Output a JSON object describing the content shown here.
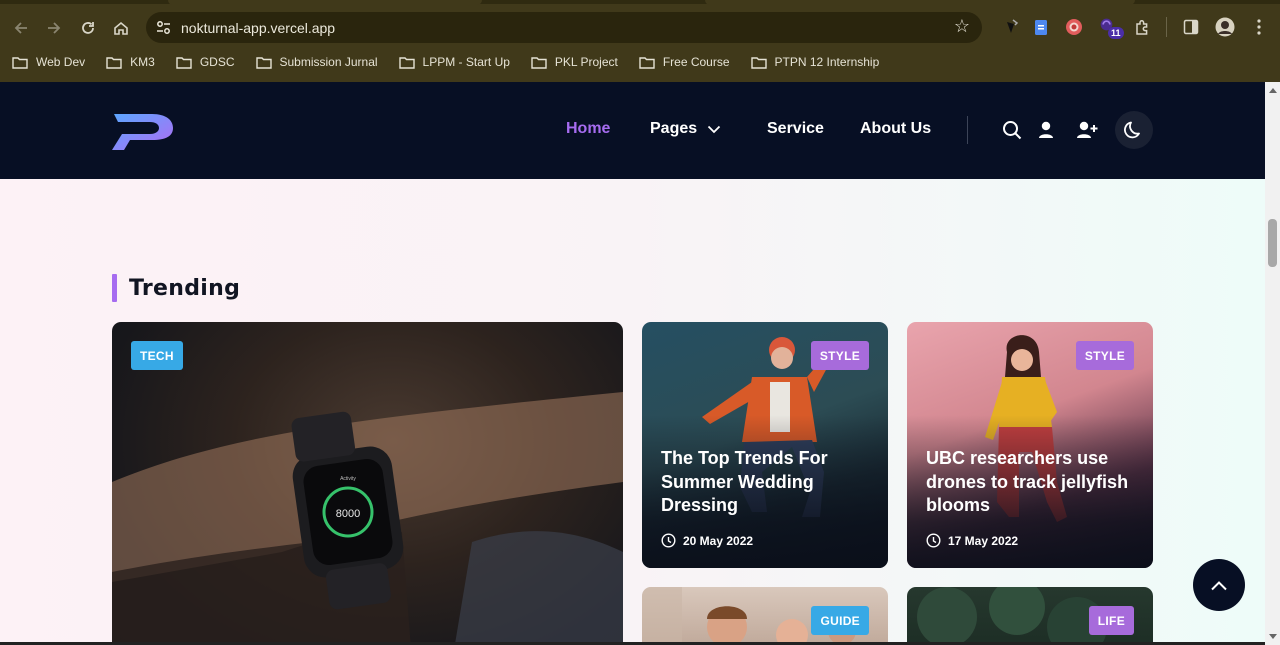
{
  "browser": {
    "url": "nokturnal-app.vercel.app",
    "extension_badge": "11",
    "bookmarks": [
      {
        "label": "Web Dev"
      },
      {
        "label": "KM3"
      },
      {
        "label": "GDSC"
      },
      {
        "label": "Submission Jurnal"
      },
      {
        "label": "LPPM - Start Up"
      },
      {
        "label": "PKL Project"
      },
      {
        "label": "Free Course"
      },
      {
        "label": "PTPN 12 Internship"
      }
    ]
  },
  "header": {
    "nav": {
      "home": "Home",
      "pages": "Pages",
      "service": "Service",
      "about": "About Us"
    },
    "colors": {
      "background": "#070f24",
      "active": "#a66cf0"
    }
  },
  "trending": {
    "title": "Trending",
    "cards": [
      {
        "category": "TECH"
      },
      {
        "category": "STYLE",
        "title": "The Top Trends For Summer Wedding Dressing",
        "date": "20 May 2022"
      },
      {
        "category": "STYLE",
        "title": "UBC researchers use drones to track jellyfish blooms",
        "date": "17 May 2022"
      },
      {
        "category": "GUIDE"
      },
      {
        "category": "LIFE"
      }
    ],
    "watch_screen": {
      "label": "Activity",
      "value": "8000"
    }
  }
}
